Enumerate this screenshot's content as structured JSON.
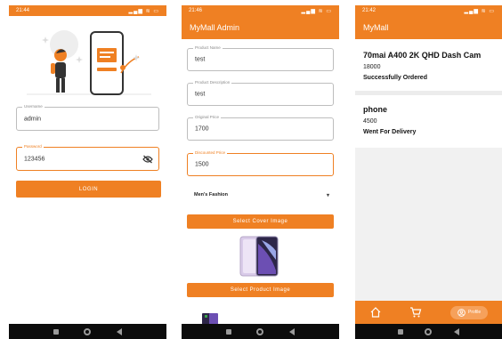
{
  "login": {
    "status_time": "21:44",
    "status_icons": "▂▄▆ ≋ ▭",
    "username_label": "Username",
    "username_value": "admin",
    "password_label": "Password",
    "password_value": "123456",
    "login_button": "LOGIN",
    "illustration_icon": "person-with-phone-illustration"
  },
  "admin": {
    "status_time": "21:46",
    "status_icons": "▂▄▆ ≋ ▭",
    "title": "MyMall Admin",
    "product_name_label": "Product Name",
    "product_name_value": "test",
    "product_description_label": "Product Description",
    "product_description_value": "test",
    "original_price_label": "Original Price",
    "original_price_value": "1700",
    "discounted_price_label": "Discounted Price",
    "discounted_price_value": "1500",
    "category_value": "Men's Fashion",
    "select_cover_button": "Select Cover Image",
    "select_product_button": "Select Product Image"
  },
  "orders": {
    "status_time": "21:42",
    "status_icons": "▂▄▆ ≋ ▭",
    "title": "MyMall",
    "items": [
      {
        "name": "70mai A400 2K QHD Dash Cam",
        "price": "18000",
        "status": "Successfully Ordered"
      },
      {
        "name": "phone",
        "price": "4500",
        "status": "Went For Delivery"
      }
    ],
    "nav_profile_label": "Profile"
  },
  "colors": {
    "accent": "#ef8023",
    "navbar": "#0c0c0c"
  }
}
